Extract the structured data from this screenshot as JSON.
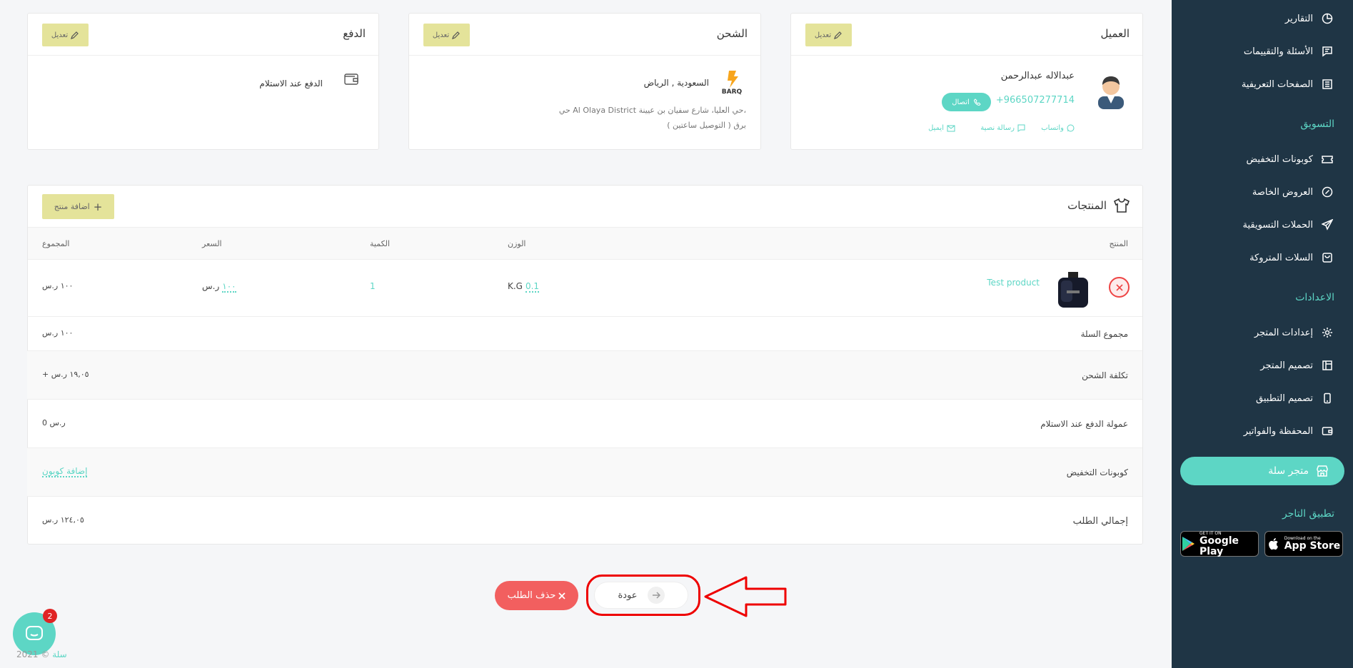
{
  "sidebar": {
    "items_top": [
      {
        "label": "التقارير",
        "icon": "chart-pie-icon"
      },
      {
        "label": "الأسئلة والتقييمات",
        "icon": "comment-icon"
      },
      {
        "label": "الصفحات التعريفية",
        "icon": "pages-icon"
      }
    ],
    "marketing_heading": "التسويق",
    "marketing_items": [
      {
        "label": "كوبونات التخفيض",
        "icon": "ticket-icon"
      },
      {
        "label": "العروض الخاصة",
        "icon": "discount-badge-icon"
      },
      {
        "label": "الحملات التسويقية",
        "icon": "paper-plane-icon"
      },
      {
        "label": "السلات المتروكة",
        "icon": "shopping-bag-icon"
      }
    ],
    "settings_heading": "الاعدادات",
    "settings_items": [
      {
        "label": "إعدادات المتجر",
        "icon": "gear-icon"
      },
      {
        "label": "تصميم المتجر",
        "icon": "layout-icon"
      },
      {
        "label": "تصميم التطبيق",
        "icon": "mobile-icon"
      },
      {
        "label": "المحفظة والفواتير",
        "icon": "wallet-icon"
      }
    ],
    "store_button": "متجر سلة",
    "merchant_app_heading": "تطبيق التاجر",
    "google_play": {
      "small": "GET IT ON",
      "big": "Google Play"
    },
    "app_store": {
      "small": "Download on the",
      "big": "App Store"
    }
  },
  "customer": {
    "title": "العميل",
    "edit": "تعديل",
    "name": "عبدالاله عبدالرحمن",
    "phone": "+966507277714",
    "call": "اتصال",
    "whatsapp": "واتساب",
    "sms": "رسالة نصية",
    "email": "ايميل"
  },
  "shipping": {
    "title": "الشحن",
    "edit": "تعديل",
    "company_logo": "BARQ",
    "location": "السعودية , الرياض",
    "address": "حي Al Olaya District حي العليا، شارع سفيان بن عيينة،",
    "note": "برق ( التوصيل ساعتين )"
  },
  "payment": {
    "title": "الدفع",
    "edit": "تعديل",
    "method": "الدفع عند الاستلام"
  },
  "products": {
    "title": "المنتجات",
    "add_button": "اضافة منتج",
    "headers": {
      "product": "المنتج",
      "weight": "الوزن",
      "qty": "الكمية",
      "price": "السعر",
      "total": "المجموع"
    },
    "item": {
      "name": "Test product",
      "weight_value": "0.1",
      "weight_unit": "K.G",
      "qty": "1",
      "price_value": "١٠٠",
      "price_currency": "ر.س",
      "total": "١٠٠ ر.س"
    }
  },
  "summary": {
    "cart_total_label": "مجموع السلة",
    "cart_total": "١٠٠ ر.س",
    "shipping_label": "تكلفة الشحن",
    "shipping": "+ ١٩,٠٥ ر.س",
    "cod_label": "عمولة الدفع عند الاستلام",
    "cod": "0 ر.س",
    "coupons_label": "كوبونات التخفيض",
    "add_coupon": "إضافة كوبون",
    "grand_total_label": "إجمالي الطلب",
    "grand_total": "١٢٤,٠٥ ر.س"
  },
  "actions": {
    "delete": "حذف الطلب",
    "back": "عودة"
  },
  "chat": {
    "unread": "2"
  },
  "footer": {
    "brand": "سلة",
    "copyright": "2021 ©"
  },
  "colors": {
    "accent": "#5dd6c5",
    "sidebar": "#1f3545",
    "edit_bg": "#e4e39a",
    "danger": "#f25f5f",
    "highlight": "#e00000"
  }
}
